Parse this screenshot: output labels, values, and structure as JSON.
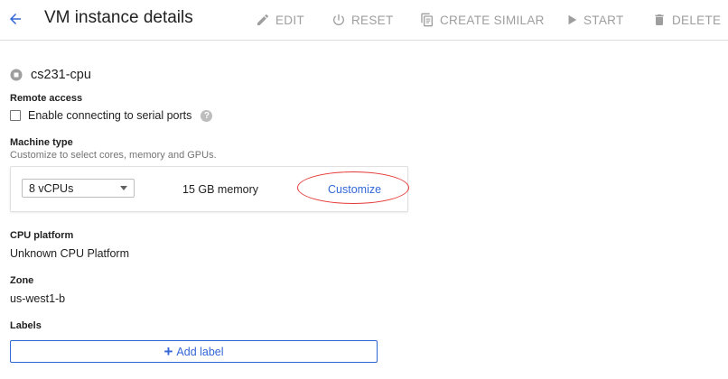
{
  "header": {
    "title": "VM instance details",
    "actions": {
      "edit": "EDIT",
      "reset": "RESET",
      "create_similar": "CREATE SIMILAR",
      "start": "START",
      "delete": "DELETE"
    }
  },
  "instance": {
    "name": "cs231-cpu",
    "status_icon": "stopped-icon"
  },
  "remote_access": {
    "label": "Remote access",
    "checkbox_label": "Enable connecting to serial ports",
    "checked": false
  },
  "machine_type": {
    "label": "Machine type",
    "hint": "Customize to select cores, memory and GPUs.",
    "selected_cpus": "8 vCPUs",
    "memory": "15 GB memory",
    "customize_label": "Customize"
  },
  "cpu_platform": {
    "label": "CPU platform",
    "value": "Unknown CPU Platform"
  },
  "zone": {
    "label": "Zone",
    "value": "us-west1-b"
  },
  "labels": {
    "label": "Labels",
    "add_label": "Add label"
  },
  "colors": {
    "accent": "#3367d6",
    "annotation": "#e53935",
    "disabled": "#9e9e9e"
  }
}
